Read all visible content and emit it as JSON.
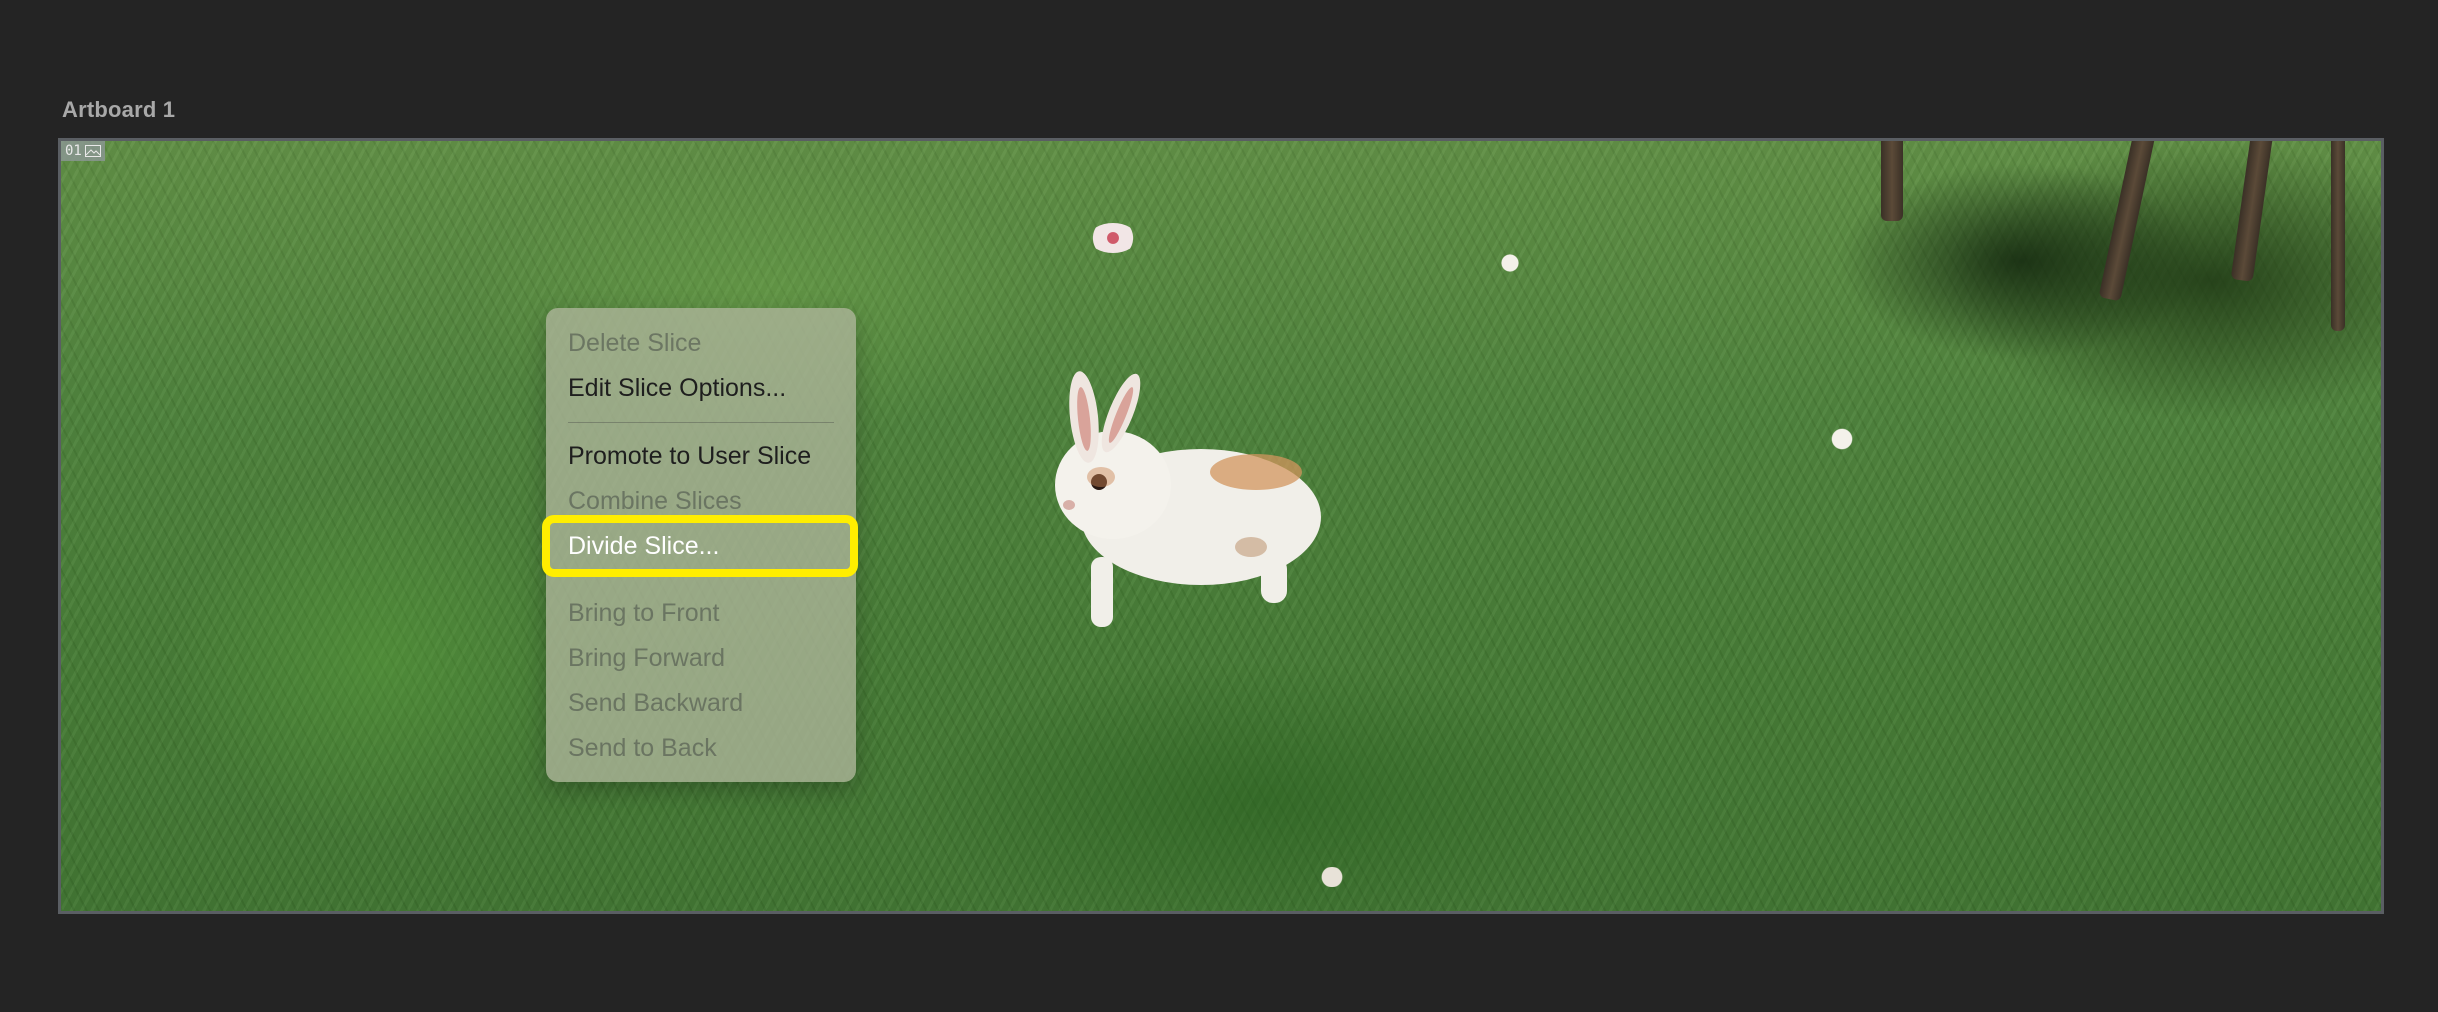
{
  "artboard": {
    "title": "Artboard 1",
    "slice_number": "01"
  },
  "context_menu": {
    "items": [
      {
        "label": "Delete Slice",
        "enabled": false
      },
      {
        "label": "Edit Slice Options...",
        "enabled": true
      },
      {
        "label": "Promote to User Slice",
        "enabled": true
      },
      {
        "label": "Combine Slices",
        "enabled": false
      },
      {
        "label": "Divide Slice...",
        "enabled": true,
        "highlighted": true
      },
      {
        "label": "Bring to Front",
        "enabled": false
      },
      {
        "label": "Bring Forward",
        "enabled": false
      },
      {
        "label": "Send Backward",
        "enabled": false
      },
      {
        "label": "Send to Back",
        "enabled": false
      }
    ]
  },
  "colors": {
    "workspace_bg": "#242424",
    "menu_highlight": "#e3b12c",
    "annotation_ring": "#ffee00"
  },
  "icons": {
    "slice_badge_icon": "image-icon"
  }
}
